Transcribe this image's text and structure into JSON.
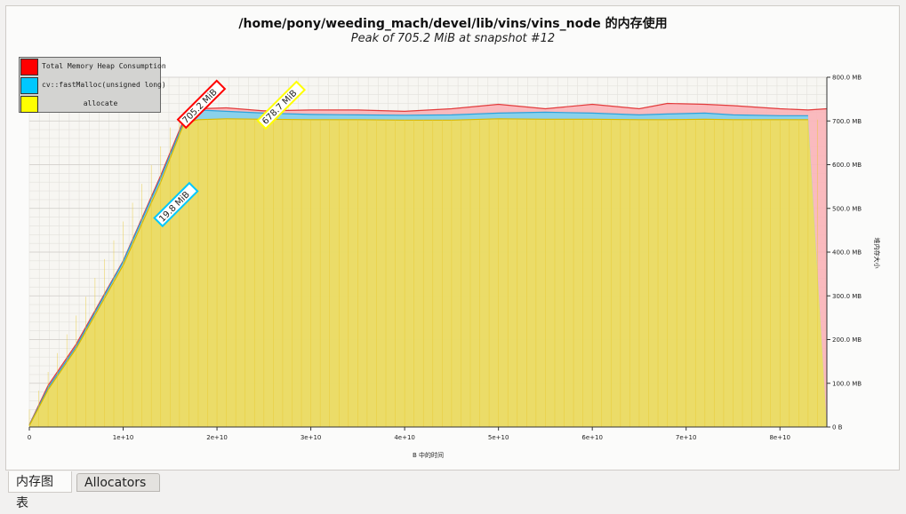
{
  "window": {
    "title": "/home/pony/weeding_mach/devel/lib/vins/vins_node 的内存使用",
    "subtitle": "Peak of 705.2 MiB at snapshot #12"
  },
  "legend": [
    {
      "label": "Total Memory Heap Consumption",
      "color": "#ff0000"
    },
    {
      "label": "cv::fastMalloc(unsigned long)",
      "color": "#00c8ff"
    },
    {
      "label": "allocate",
      "color": "#ffff00"
    }
  ],
  "tabs": [
    {
      "label": "内存图表",
      "active": true
    },
    {
      "label": "Allocators",
      "active": false
    }
  ],
  "chart_data": {
    "type": "area",
    "xlabel": "B 中的时间",
    "ylabel": "堆内存大小",
    "xlim": [
      0,
      85000000000
    ],
    "ylim": [
      0,
      800
    ],
    "x_ticks": [
      "0",
      "1e+10",
      "2e+10",
      "3e+10",
      "4e+10",
      "5e+10",
      "6e+10",
      "7e+10",
      "8e+10"
    ],
    "y_ticks": [
      "0 B",
      "100.0 MB",
      "200.0 MB",
      "300.0 MB",
      "400.0 MB",
      "500.0 MB",
      "600.0 MB",
      "700.0 MB",
      "800.0 MB"
    ],
    "x": [
      0,
      2000000000,
      5000000000,
      10000000000,
      14000000000,
      16500000000,
      18000000000,
      21000000000,
      25000000000,
      30000000000,
      35000000000,
      40000000000,
      45000000000,
      50000000000,
      55000000000,
      60000000000,
      65000000000,
      68000000000,
      72000000000,
      75000000000,
      80000000000,
      83000000000,
      85000000000
    ],
    "series": [
      {
        "name": "Total Memory Heap Consumption",
        "color": "#ff0000",
        "values": [
          5,
          95,
          190,
          380,
          575,
          705,
          728,
          730,
          723,
          725,
          725,
          722,
          728,
          738,
          728,
          738,
          728,
          740,
          738,
          735,
          728,
          725,
          728
        ]
      },
      {
        "name": "cv::fastMalloc(unsigned long)",
        "color": "#00c8ff",
        "values": [
          4,
          90,
          185,
          378,
          570,
          700,
          725,
          722,
          718,
          715,
          714,
          713,
          714,
          718,
          720,
          718,
          714,
          716,
          718,
          714,
          712,
          712,
          0
        ]
      },
      {
        "name": "allocate",
        "color": "#ffff00",
        "values": [
          3,
          85,
          180,
          370,
          560,
          695,
          703,
          705,
          704,
          703,
          703,
          702,
          702,
          705,
          704,
          704,
          703,
          703,
          704,
          703,
          703,
          703,
          0
        ]
      }
    ],
    "annotations": [
      {
        "text": "705.2 MiB",
        "x": 16500000000,
        "y": 705.2,
        "color": "#ff0000"
      },
      {
        "text": "678.7 MiB",
        "x": 25000000000,
        "y": 703,
        "color": "#ffff00"
      },
      {
        "text": "19.8 MiB",
        "x": 14000000000,
        "y": 480,
        "color": "#00c8ff"
      }
    ]
  }
}
